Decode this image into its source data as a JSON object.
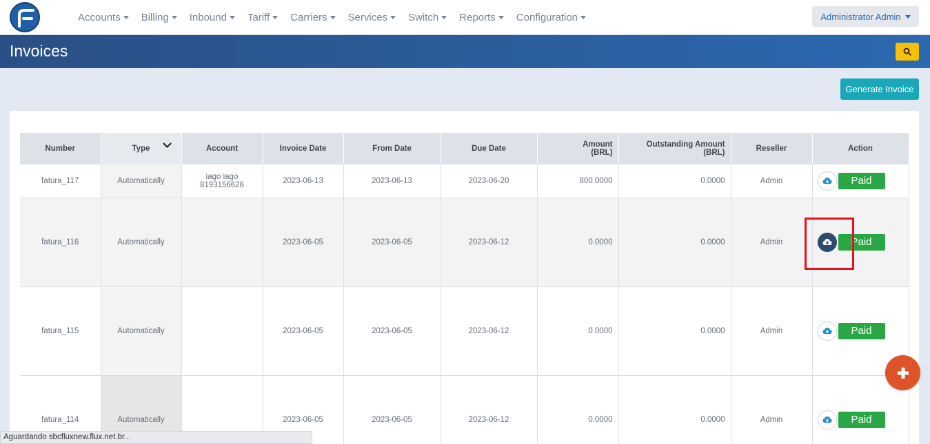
{
  "nav": {
    "menu": [
      {
        "label": "Accounts"
      },
      {
        "label": "Billing"
      },
      {
        "label": "Inbound"
      },
      {
        "label": "Tariff"
      },
      {
        "label": "Carriers"
      },
      {
        "label": "Services"
      },
      {
        "label": "Switch"
      },
      {
        "label": "Reports"
      },
      {
        "label": "Configuration"
      }
    ],
    "user": "Administrator Admin"
  },
  "header": {
    "title": "Invoices"
  },
  "toolbar": {
    "generate_label": "Generate Invoice"
  },
  "table": {
    "headers": {
      "number": "Number",
      "type": "Type",
      "account": "Account",
      "invoice_date": "Invoice Date",
      "from_date": "From Date",
      "due_date": "Due Date",
      "amount_line1": "Amount",
      "amount_line2": "(BRL)",
      "outstanding_line1": "Outstanding Amount",
      "outstanding_line2": "(BRL)",
      "reseller": "Reseller",
      "action": "Action"
    },
    "rows": [
      {
        "number": "fatura_117",
        "type": "Automatically",
        "account_line1": "iago iago",
        "account_line2": "8193156626",
        "invoice_date": "2023-06-13",
        "from_date": "2023-06-13",
        "due_date": "2023-06-20",
        "amount": "800.0000",
        "outstanding": "0.0000",
        "reseller": "Admin",
        "status": "Paid"
      },
      {
        "number": "fatura_116",
        "type": "Automatically",
        "account_line1": "",
        "account_line2": "",
        "invoice_date": "2023-06-05",
        "from_date": "2023-06-05",
        "due_date": "2023-06-12",
        "amount": "0.0000",
        "outstanding": "0.0000",
        "reseller": "Admin",
        "status": "Paid"
      },
      {
        "number": "fatura_115",
        "type": "Automatically",
        "account_line1": "",
        "account_line2": "",
        "invoice_date": "2023-06-05",
        "from_date": "2023-06-05",
        "due_date": "2023-06-12",
        "amount": "0.0000",
        "outstanding": "0.0000",
        "reseller": "Admin",
        "status": "Paid"
      },
      {
        "number": "fatura_114",
        "type": "Automatically",
        "account_line1": "",
        "account_line2": "",
        "invoice_date": "2023-06-05",
        "from_date": "2023-06-05",
        "due_date": "2023-06-12",
        "amount": "0.0000",
        "outstanding": "0.0000",
        "reseller": "Admin",
        "status": "Paid"
      }
    ]
  },
  "status_bar": "Aguardando sbcfluxnew.flux.net.br...",
  "icons": {
    "logo": "flux-logo-icon",
    "search": "search-icon",
    "download": "cloud-download-icon",
    "sort": "chevron-down-icon",
    "add": "plus-icon"
  },
  "colors": {
    "header_bar": "#2c69b0",
    "search_button": "#f5bf0a",
    "generate_button": "#1aa8b9",
    "paid_button": "#29a744",
    "fab": "#de5429",
    "highlight": "#e8121f"
  }
}
